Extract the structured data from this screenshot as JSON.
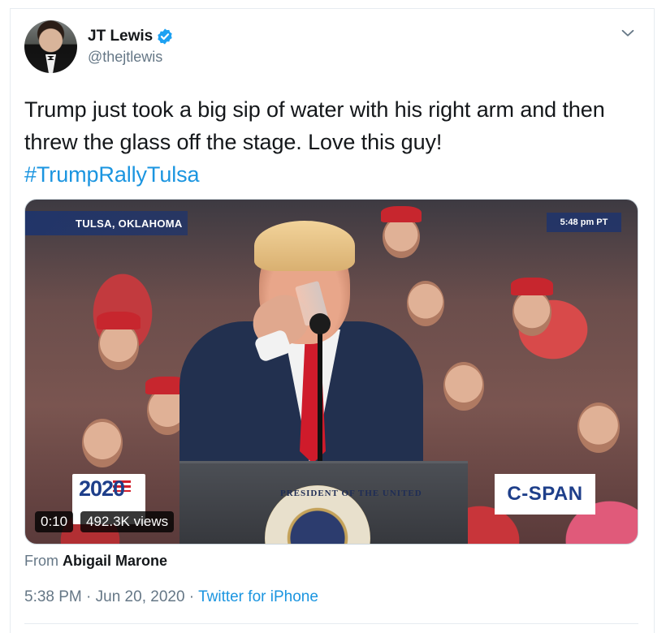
{
  "author": {
    "name": "JT Lewis",
    "handle": "@thejtlewis",
    "avatar_icon": "profile-photo",
    "verified_icon": "verified-badge-icon"
  },
  "tweet": {
    "text": "Trump just took a big sip of water with his right arm and then threw the glass off the stage. Love this guy!",
    "hashtag": "#TrumpRallyTulsa"
  },
  "video": {
    "location": "TULSA, OKLAHOMA",
    "time": "5:48 pm PT",
    "logo_text": "2020",
    "network": "C-SPAN",
    "seal_text": "PRESIDENT OF THE UNITED",
    "duration": "0:10",
    "views": "492.3K views"
  },
  "attribution": {
    "prefix": "From",
    "name": "Abigail Marone"
  },
  "meta": {
    "timestamp": "5:38 PM · Jun 20, 2020 · ",
    "source": "Twitter for iPhone"
  },
  "colors": {
    "link": "#1b95e0",
    "secondary": "#657786",
    "verified": "#1da1f2"
  }
}
